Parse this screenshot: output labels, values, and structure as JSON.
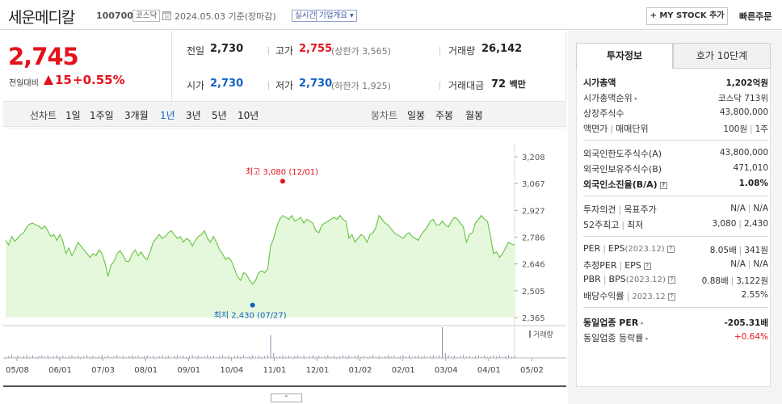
{
  "header": {
    "company_name": "세운메디칼",
    "code": "100700",
    "market": "코스닥",
    "date": "2024.05.03",
    "date_suffix": "기준(장마감)",
    "realtime": "실시간",
    "overview": "기업개요",
    "overview_arrow": "▾",
    "mystock": "+ MY STOCK 추가",
    "quick_order": "빠른주문"
  },
  "quote": {
    "price": "2,745",
    "change_label": "전일대비",
    "change_value": "15",
    "change_pct": "+0.55%",
    "sep": "|",
    "prev_label": "전일",
    "prev_value": "2,730",
    "high_label": "고가",
    "high_value": "2,755",
    "upper_limit_label": "(상한가",
    "upper_limit_value": "3,565)",
    "volume_label": "거래량",
    "volume_value": "26,142",
    "open_label": "시가",
    "open_value": "2,730",
    "low_label": "저가",
    "low_value": "2,730",
    "lower_limit_label": "(하한가",
    "lower_limit_value": "1,925)",
    "amount_label": "거래대금",
    "amount_value": "72",
    "amount_unit": "백만"
  },
  "periods": {
    "line_label": "선차트",
    "line_items": [
      "1일",
      "1주일",
      "3개월",
      "1년",
      "3년",
      "5년",
      "10년"
    ],
    "active": "1년",
    "candle_label": "봉차트",
    "candle_items": [
      "일봉",
      "주봉",
      "월봉"
    ]
  },
  "chart_data": {
    "type": "area",
    "y_ticks": [
      "3,208",
      "3,067",
      "2,927",
      "2,786",
      "2,646",
      "2,505",
      "2,365"
    ],
    "ylim": [
      2365,
      3208
    ],
    "x_ticks": [
      "05/08",
      "06/01",
      "07/03",
      "08/01",
      "09/01",
      "10/04",
      "11/01",
      "12/01",
      "01/02",
      "02/01",
      "03/04",
      "04/01",
      "05/02"
    ],
    "high_label": "최고 3,080 (12/01)",
    "low_label": "최저 2,430 (07/27)",
    "volume_label": "거래량",
    "accent_line": "#63c33e",
    "accent_fill": "#e6f8dc",
    "values": [
      2770,
      2745,
      2790,
      2765,
      2780,
      2800,
      2810,
      2840,
      2855,
      2860,
      2850,
      2845,
      2830,
      2845,
      2820,
      2790,
      2800,
      2770,
      2800,
      2765,
      2700,
      2730,
      2690,
      2720,
      2760,
      2740,
      2720,
      2700,
      2680,
      2700,
      2690,
      2720,
      2700,
      2650,
      2580,
      2640,
      2660,
      2700,
      2715,
      2690,
      2660,
      2660,
      2700,
      2720,
      2690,
      2710,
      2680,
      2670,
      2710,
      2760,
      2780,
      2800,
      2780,
      2790,
      2810,
      2820,
      2800,
      2780,
      2790,
      2760,
      2780,
      2770,
      2740,
      2770,
      2790,
      2800,
      2820,
      2780,
      2760,
      2790,
      2760,
      2720,
      2700,
      2670,
      2680,
      2660,
      2620,
      2580,
      2560,
      2600,
      2590,
      2560,
      2540,
      2560,
      2600,
      2610,
      2600,
      2620,
      2740,
      2780,
      2840,
      2880,
      2900,
      2890,
      2880,
      2900,
      2870,
      2880,
      2890,
      2860,
      2880,
      2870,
      2860,
      2820,
      2810,
      2850,
      2860,
      2870,
      2880,
      2890,
      2880,
      2900,
      2880,
      2870,
      2780,
      2800,
      2760,
      2780,
      2800,
      2790,
      2760,
      2800,
      2810,
      2840,
      2900,
      2880,
      2860,
      2850,
      2830,
      2810,
      2800,
      2790,
      2780,
      2800,
      2810,
      2790,
      2780,
      2770,
      2800,
      2820,
      2840,
      2870,
      2880,
      2850,
      2850,
      2870,
      2850,
      2840,
      2870,
      2890,
      2880,
      2860,
      2840,
      2760,
      2800,
      2810,
      2860,
      2880,
      2900,
      2880,
      2870,
      2790,
      2700,
      2710,
      2680,
      2700,
      2730,
      2760,
      2750,
      2745
    ]
  },
  "panel": {
    "tab_invest": "투자정보",
    "tab_quote": "호가 10단계",
    "market_cap_label": "시가총액",
    "market_cap_value": "1,202억원",
    "cap_rank_label": "시가총액순위",
    "cap_rank_value": "코스닥 713위",
    "listed_shares_label": "상장주식수",
    "listed_shares_value": "43,800,000",
    "face_label": "액면가",
    "trade_unit_label": "매매단위",
    "face_value": "100원",
    "trade_unit_value": "1주",
    "foreign_limit_label": "외국인한도주식수(A)",
    "foreign_limit_value": "43,800,000",
    "foreign_hold_label": "외국인보유주식수(B)",
    "foreign_hold_value": "471,010",
    "foreign_ratio_label": "외국인소진율(B/A)",
    "foreign_ratio_value": "1.08%",
    "opinion_label": "투자의견",
    "target_label": "목표주가",
    "opinion_value": "N/A",
    "target_value": "N/A",
    "w52_high_label": "52주최고",
    "w52_low_label": "최저",
    "w52_high_value": "3,080",
    "w52_low_value": "2,430",
    "per_label": "PER",
    "eps_label": "EPS",
    "eps_year": "(2023.12)",
    "per_value": "8.05배",
    "eps_value": "341원",
    "est_per_label": "추정PER",
    "est_eps_label": "EPS",
    "est_per_value": "N/A",
    "est_eps_value": "N/A",
    "pbr_label": "PBR",
    "bps_label": "BPS",
    "bps_year": "(2023.12)",
    "pbr_value": "0.88배",
    "bps_value": "3,122원",
    "dividend_label": "배당수익률",
    "dividend_year": "2023.12",
    "dividend_value": "2.55%",
    "sector_per_label": "동일업종 PER",
    "sector_per_value": "-205.31배",
    "sector_rate_label": "동일업종 등락률",
    "sector_rate_value": "+0.64%",
    "info_icon": "?",
    "right_arrow": "▸"
  }
}
